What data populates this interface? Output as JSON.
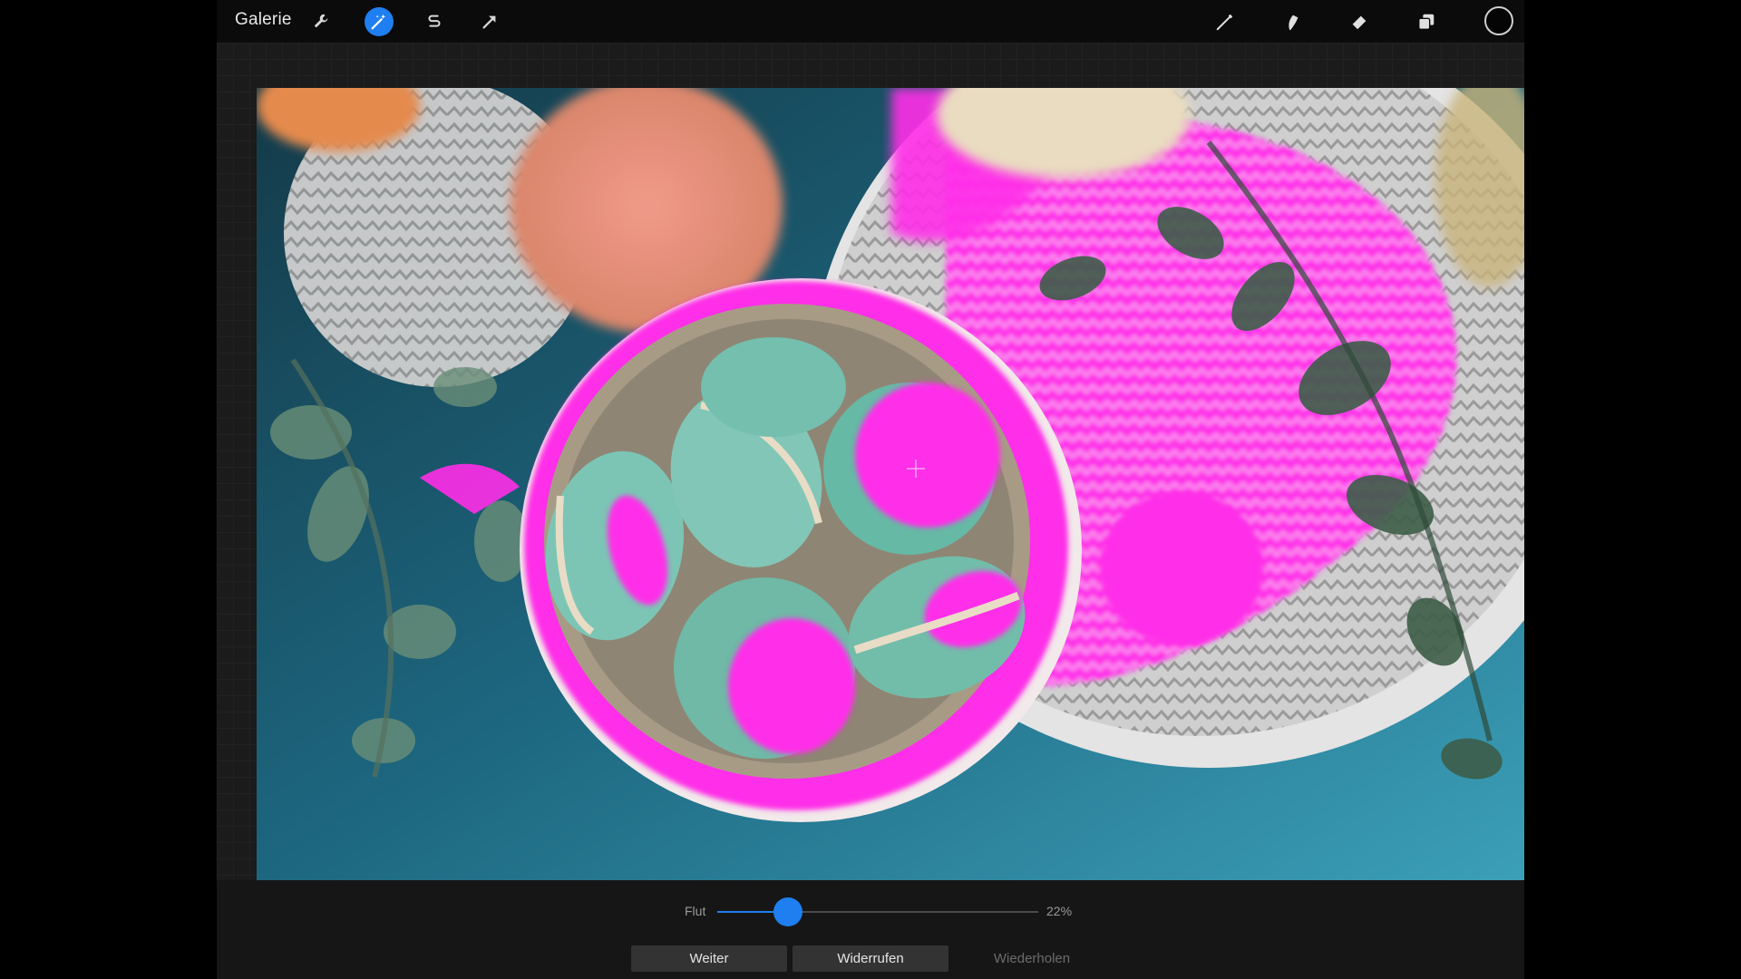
{
  "topbar": {
    "gallery_label": "Galerie",
    "left_tools": [
      {
        "icon": "wrench-icon",
        "active": false
      },
      {
        "icon": "magic-wand-icon",
        "active": true
      },
      {
        "icon": "selection-s-icon",
        "active": false
      },
      {
        "icon": "arrow-icon",
        "active": false
      }
    ],
    "right_tools": [
      "brush-icon",
      "smudge-icon",
      "eraser-icon",
      "layers-icon"
    ],
    "current_color": "#050505"
  },
  "slider": {
    "label": "Flut",
    "value_text": "22%",
    "value_fraction": 0.22
  },
  "actions": {
    "continue_label": "Weiter",
    "undo_label": "Widerrufen",
    "redo_label": "Wiederholen"
  },
  "colors": {
    "accent": "#1f7ff0",
    "selection_highlight": "#ff1ee6",
    "macaron_mint": "#7cc5b5",
    "background_teal": "#1f6f86"
  }
}
